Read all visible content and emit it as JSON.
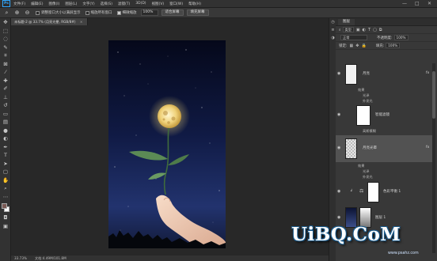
{
  "app": {
    "logo": "Ps"
  },
  "menu": [
    "文件(F)",
    "编辑(E)",
    "图像(I)",
    "图层(L)",
    "文字(Y)",
    "选择(S)",
    "滤镜(T)",
    "3D(D)",
    "视图(V)",
    "窗口(W)",
    "帮助(H)"
  ],
  "window_controls": [
    "—",
    "□",
    "✕"
  ],
  "options": {
    "check1": "调整窗口大小以满屏显示",
    "check2": "缩放所有窗口",
    "check3": "细微缩放",
    "zoom": "100%",
    "btn_fit": "适合屏幕",
    "btn_fill": "填充屏幕"
  },
  "document": {
    "tab_title": "未标题-2 @ 33.7% (月亮光晕, RGB/8#)",
    "tab_close": "×",
    "status_zoom": "33.73%",
    "status_doc": "文档:4.49M/101.8M"
  },
  "layers_panel": {
    "tab": "图层",
    "filter_label": "类型",
    "blend_mode": "正常",
    "opacity_label": "不透明度:",
    "opacity": "100%",
    "lock_label": "锁定:",
    "fill_label": "填充:",
    "fill": "100%",
    "fx": "fx",
    "layers": [
      {
        "name": "月亮",
        "effects_label": "效果",
        "effects": [
          "光泽",
          "外发光"
        ]
      },
      {
        "name": "智能滤镜",
        "filter": "高斯模糊"
      },
      {
        "name": "月亮光晕",
        "effects_label": "效果",
        "effects": [
          "光泽",
          "外发光"
        ]
      },
      {
        "name": "色彩平衡 1"
      },
      {
        "name": "图层 1"
      }
    ]
  },
  "watermark": {
    "text": "UiBQ.CoM",
    "sub": "www.psahz.com"
  },
  "colors": {
    "selection": "#525252",
    "accent": "#31a8ff"
  }
}
